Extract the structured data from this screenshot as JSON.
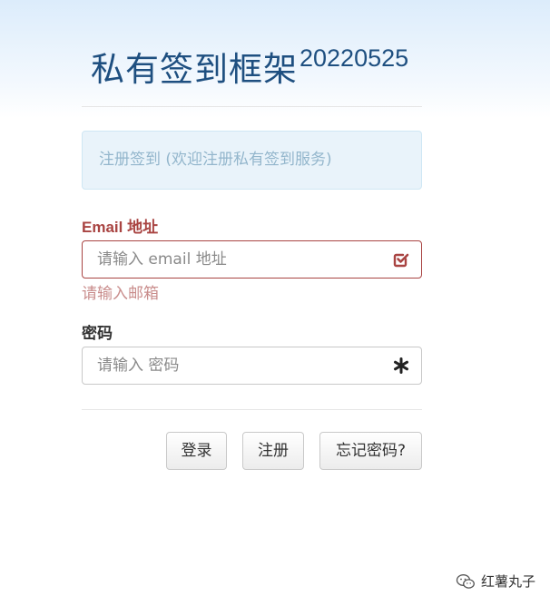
{
  "header": {
    "title": "私有签到框架",
    "version": "20220525"
  },
  "alert": {
    "text": "注册签到 (欢迎注册私有签到服务)"
  },
  "form": {
    "email": {
      "label": "Email 地址",
      "placeholder": "请输入 email 地址",
      "value": "",
      "error": "请输入邮箱",
      "icon": "checkmark-square-icon",
      "state_color": "#a94442"
    },
    "password": {
      "label": "密码",
      "placeholder": "请输入 密码",
      "value": "",
      "icon": "asterisk-icon"
    }
  },
  "buttons": {
    "login": "登录",
    "register": "注册",
    "forgot": "忘记密码?"
  },
  "watermark": {
    "text": "红薯丸子",
    "icon": "wechat-icon"
  },
  "colors": {
    "title": "#1e4f80",
    "error": "#a94442",
    "alert_bg": "#e9f3fa",
    "alert_text": "#93b6cc"
  }
}
